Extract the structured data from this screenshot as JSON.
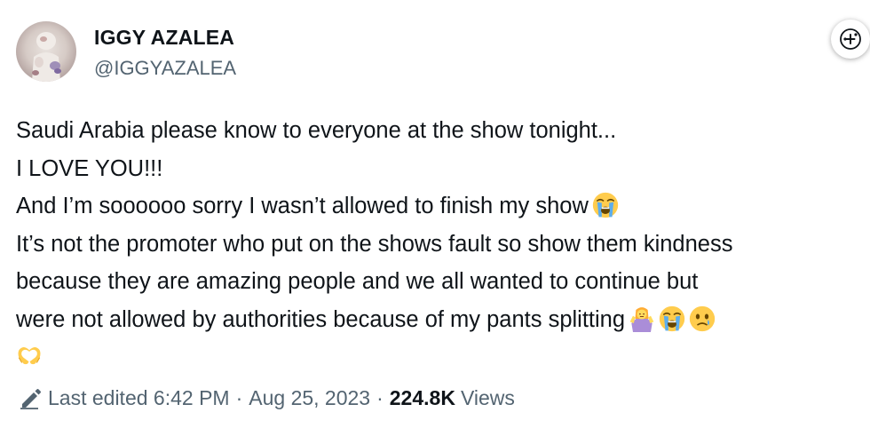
{
  "author": {
    "display_name": "IGGY AZALEA",
    "handle": "@IGGYAZALEA",
    "avatar_icon": "profile-photo"
  },
  "actions": {
    "grok_icon": "grok-explain-icon"
  },
  "tweet": {
    "lines": [
      "Saudi Arabia please know to everyone at the show tonight...",
      "I LOVE YOU!!!",
      "And I’m soooooo sorry I wasn’t allowed to finish my show",
      "It’s not the promoter who put on the shows fault so show them kindness",
      "because they are amazing people and we all wanted to continue but",
      "were not allowed by authorities because of my pants splitting"
    ],
    "emojis": {
      "line3": [
        "loudly-crying-face-emoji"
      ],
      "line6": [
        "person-shrugging-emoji",
        "loudly-crying-face-emoji",
        "face-holding-back-tears-emoji"
      ],
      "line7": [
        "heart-hands-emoji"
      ]
    }
  },
  "footer": {
    "edit_icon": "pencil-icon",
    "last_edited": "Last edited 6:42 PM",
    "separator": "·",
    "date": "Aug 25, 2023",
    "views_count": "224.8K",
    "views_label": "Views"
  },
  "colors": {
    "primary_text": "#0f1419",
    "secondary_text": "#536471",
    "background": "#ffffff"
  }
}
